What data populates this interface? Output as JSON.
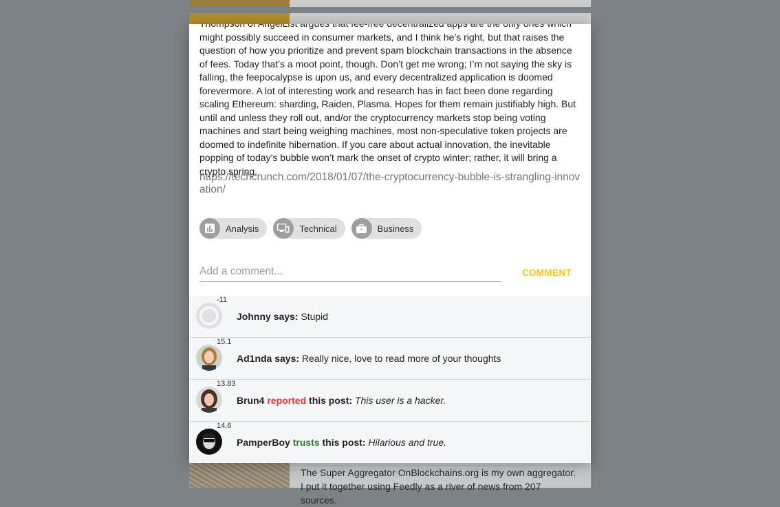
{
  "background": {
    "bottom_text": "The Super Aggregator OnBlockchains.org is my own aggregator. I put it together using Feedly as a river of news from 207 sources."
  },
  "article": {
    "body": "Thompson of AngelList argues that fee-free decentralized apps are the only ones which might possibly succeed in consumer markets, and I think he’s right, but that raises the question of how you prioritize and prevent spam blockchain transactions in the absence of fees. Today that’s a moot point, though. Don’t get me wrong; I’m not saying the sky is falling, the feepocalypse is upon us, and every decentralized application is doomed forevermore. A lot of interesting work and research has in fact been done regarding scaling Ethereum: sharding, Raiden, Plasma. Hopes for them remain justifiably high. But until and unless they roll out, and/or the cryptocurrency markets stop being voting machines and start being weighing machines, most non-speculative token projects are doomed to indefinite hibernation. If you care about actual innovation, the inevitable popping of today’s bubble won’t mark the onset of crypto winter; rather, it will bring a crypto spring.",
    "url": "https://techcrunch.com/2018/01/07/the-cryptocurrency-bubble-is-strangling-innovation/"
  },
  "tags": [
    {
      "label": "Analysis",
      "icon": "bar-chart-icon"
    },
    {
      "label": "Technical",
      "icon": "devices-icon"
    },
    {
      "label": "Business",
      "icon": "briefcase-icon"
    }
  ],
  "comment_form": {
    "placeholder": "Add a comment...",
    "button_label": "COMMENT"
  },
  "comments": [
    {
      "score": "-11",
      "user": "Johnny",
      "verb": "says:",
      "text": "Stupid"
    },
    {
      "score": "15.1",
      "user": "Ad1nda",
      "verb": "says:",
      "text": "Really nice, love to read more of your thoughts"
    },
    {
      "score": "13.83",
      "user": "Brun4",
      "action": "reported",
      "verb": "this post:",
      "text": "This user is a hacker."
    },
    {
      "score": "14.6",
      "user": "PamperBoy",
      "action": "trusts",
      "verb": "this post:",
      "text": "Hilarious and true."
    }
  ],
  "colors": {
    "accent": "#f5c518",
    "reported": "#e53935",
    "trusts": "#2e7d32"
  }
}
